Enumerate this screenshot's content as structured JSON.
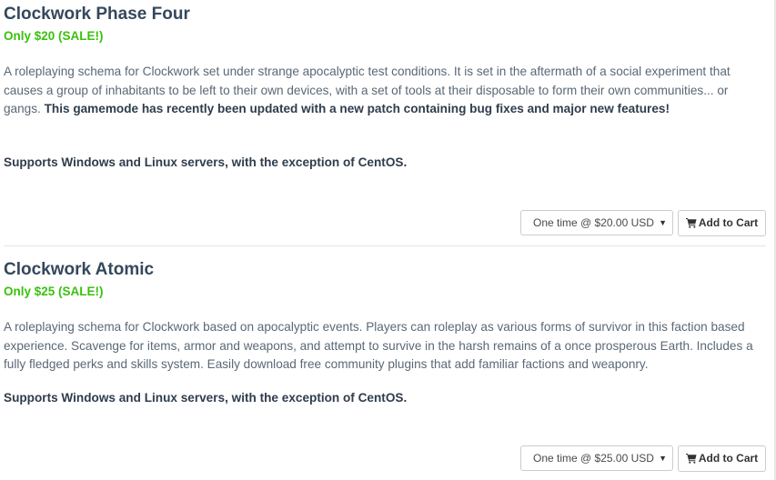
{
  "products": [
    {
      "title": "Clockwork Phase Four",
      "price": "Only $20 (SALE!)",
      "description": "A roleplaying schema for Clockwork set under strange apocalyptic test conditions. It is set in the aftermath of a social experiment that causes a group of inhabitants to be left to their own devices, with a set of tools at their disposable to form their own communities... or gangs. ",
      "description_bold": "This gamemode has recently been updated with a new patch containing bug fixes and major new features!",
      "support": "Supports Windows and Linux servers, with the exception of CentOS.",
      "billing_option": "One time @ $20.00 USD",
      "add_to_cart": "Add to Cart"
    },
    {
      "title": "Clockwork Atomic",
      "price": "Only $25 (SALE!)",
      "description": "A roleplaying schema for Clockwork based on apocalyptic events. Players can roleplay as various forms of survivor in this faction based experience. Scavenge for items, armor and weapons, and attempt to survive in the harsh remains of a once prosperous Earth. Includes a fully fledged perks and skills system. Easily download free community plugins that add familiar factions and weaponry.",
      "support": "Supports Windows and Linux servers, with the exception of CentOS.",
      "billing_option": "One time @ $25.00 USD",
      "add_to_cart": "Add to Cart"
    }
  ],
  "icons": {
    "cart": "shopping-cart-icon",
    "dropdown": "caret-down-icon"
  },
  "colors": {
    "title": "#35485c",
    "price": "#3ac10e",
    "body_text": "#5a6876",
    "divider": "#e5e5e5"
  }
}
